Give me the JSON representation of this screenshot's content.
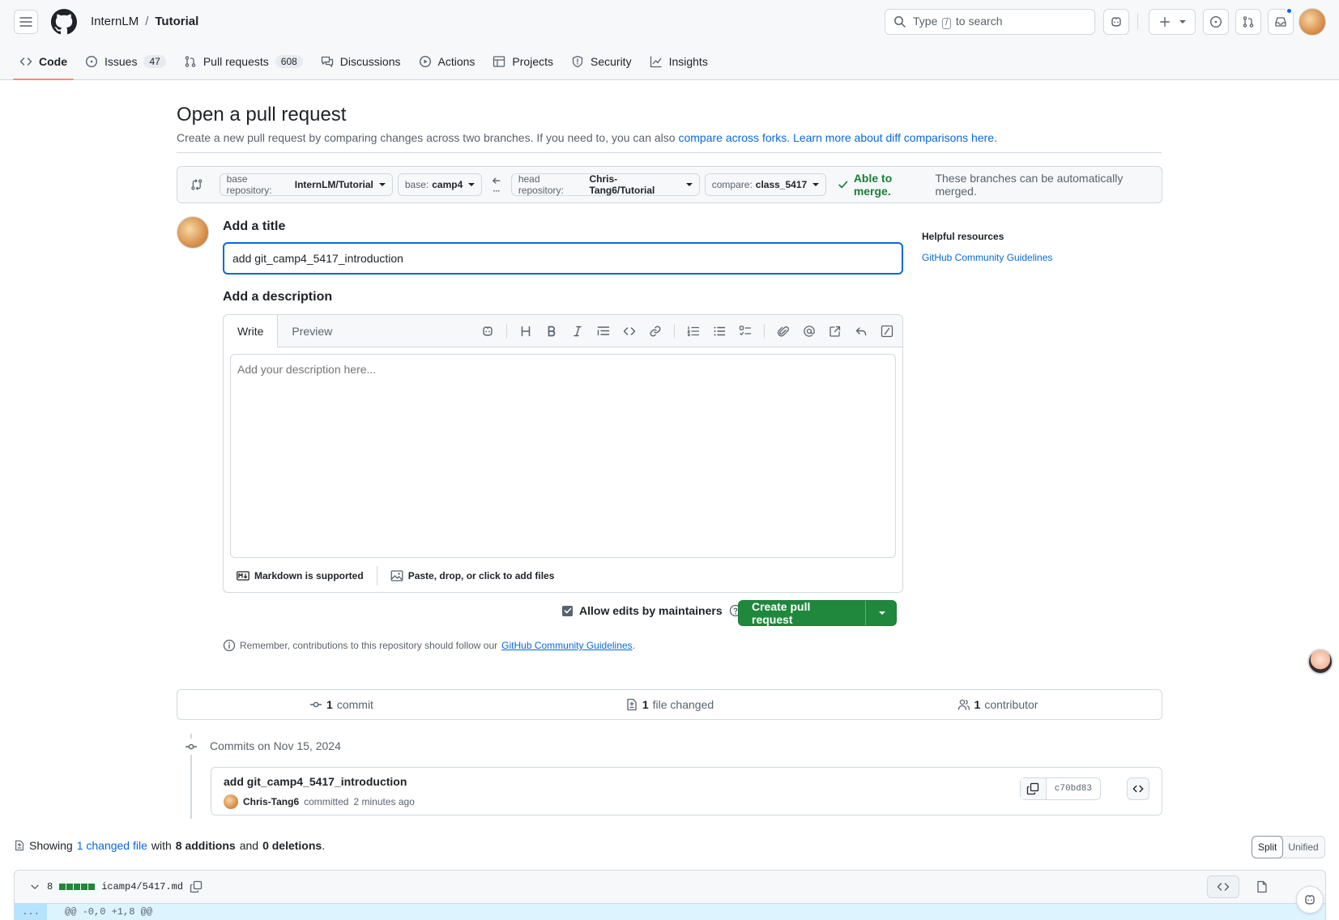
{
  "header": {
    "owner": "InternLM",
    "separator": "/",
    "repo": "Tutorial",
    "search_prefix": "Type",
    "search_key": "/",
    "search_suffix": "to search"
  },
  "nav": {
    "tabs": [
      {
        "label": "Code",
        "icon": "code-icon",
        "selected": true
      },
      {
        "label": "Issues",
        "icon": "issue-opened-icon",
        "count": "47"
      },
      {
        "label": "Pull requests",
        "icon": "git-pull-request-icon",
        "count": "608"
      },
      {
        "label": "Discussions",
        "icon": "comment-discussion-icon"
      },
      {
        "label": "Actions",
        "icon": "play-icon"
      },
      {
        "label": "Projects",
        "icon": "table-icon"
      },
      {
        "label": "Security",
        "icon": "shield-icon"
      },
      {
        "label": "Insights",
        "icon": "graph-icon"
      }
    ]
  },
  "page": {
    "title": "Open a pull request",
    "subtitle_text": "Create a new pull request by comparing changes across two branches. If you need to, you can also",
    "compare_forks_link": "compare across forks.",
    "learn_more_link": "Learn more about diff comparisons here."
  },
  "range": {
    "base_repo_label": "base repository:",
    "base_repo_value": "InternLM/Tutorial",
    "base_label": "base:",
    "base_value": "camp4",
    "head_repo_label": "head repository:",
    "head_repo_value": "Chris-Tang6/Tutorial",
    "compare_label": "compare:",
    "compare_value": "class_5417",
    "merge_status": "Able to merge.",
    "merge_detail": "These branches can be automatically merged."
  },
  "form": {
    "title_label": "Add a title",
    "title_value": "add git_camp4_5417_introduction",
    "description_label": "Add a description",
    "write_tab": "Write",
    "preview_tab": "Preview",
    "description_placeholder": "Add your description here...",
    "markdown_note": "Markdown is supported",
    "attach_note": "Paste, drop, or click to add files",
    "allow_edits_label": "Allow edits by maintainers",
    "allow_edits_checked": true,
    "create_button": "Create pull request",
    "remember_text": "Remember, contributions to this repository should follow our",
    "remember_link": "GitHub Community Guidelines",
    "remember_end": "."
  },
  "sidebar": {
    "heading": "Helpful resources",
    "link": "GitHub Community Guidelines"
  },
  "stats": {
    "commits_count": "1",
    "commits_label": "commit",
    "files_count": "1",
    "files_label": "file changed",
    "contributors_count": "1",
    "contributors_label": "contributor"
  },
  "commits": {
    "date_heading": "Commits on Nov 15, 2024",
    "message": "add git_camp4_5417_introduction",
    "author": "Chris-Tang6",
    "action": "committed",
    "time": "2 minutes ago",
    "sha": "c70bd83"
  },
  "diff": {
    "showing": "Showing",
    "changed_file_link": "1 changed file",
    "with": "with",
    "additions": "8 additions",
    "and": "and",
    "deletions": "0 deletions",
    "period": ".",
    "split_label": "Split",
    "unified_label": "Unified",
    "file_change_count": "8",
    "file_path": "icamp4/5417.md",
    "hunk_gutter": "...",
    "hunk_header": "@@ -0,0 +1,8 @@"
  },
  "colors": {
    "accent": "#0969da",
    "success": "#1a7f37",
    "primary_button": "#1f883d",
    "selected_tab_underline": "#fd8c73"
  }
}
